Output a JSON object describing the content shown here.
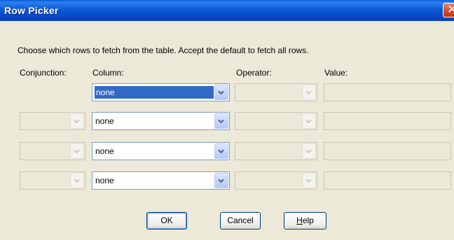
{
  "window": {
    "title": "Row Picker"
  },
  "intro": "Choose which rows to fetch from the table.  Accept the default to fetch all rows.",
  "headers": {
    "conjunction": "Conjunction:",
    "column": "Column:",
    "operator": "Operator:",
    "value": "Value:"
  },
  "rows": [
    {
      "column": "none",
      "conjunction_enabled": false,
      "column_selected": true
    },
    {
      "column": "none",
      "conjunction_enabled": false,
      "column_selected": false
    },
    {
      "column": "none",
      "conjunction_enabled": false,
      "column_selected": false
    },
    {
      "column": "none",
      "conjunction_enabled": false,
      "column_selected": false
    }
  ],
  "buttons": {
    "ok": "OK",
    "cancel": "Cancel",
    "help_prefix": "",
    "help_mnemonic": "H",
    "help_rest": "elp"
  },
  "icons": {
    "close": "close-icon",
    "dropdown": "chevron-down-icon"
  },
  "colors": {
    "title_bar": "#0a5fd8",
    "selection": "#316ac5",
    "dialog_bg": "#ece9d8"
  }
}
